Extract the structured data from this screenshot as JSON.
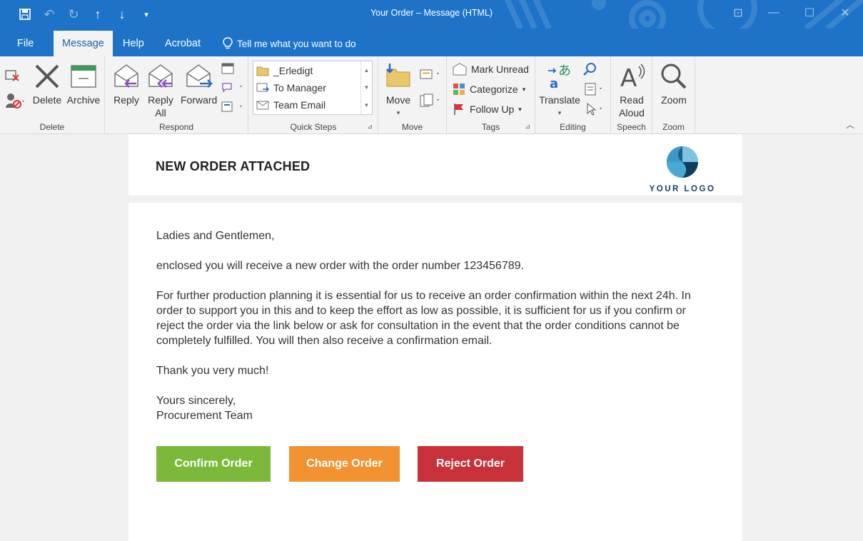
{
  "window": {
    "title": "Your Order  –  Message (HTML)"
  },
  "tabs": [
    {
      "label": "File"
    },
    {
      "label": "Message"
    },
    {
      "label": "Help"
    },
    {
      "label": "Acrobat"
    }
  ],
  "tell_me": "Tell me what you want to do",
  "ribbon": {
    "delete_group": {
      "label": "Delete",
      "delete": "Delete",
      "archive": "Archive"
    },
    "respond_group": {
      "label": "Respond",
      "reply": "Reply",
      "reply_all_1": "Reply",
      "reply_all_2": "All",
      "forward": "Forward"
    },
    "quick_steps": {
      "label": "Quick Steps",
      "items": [
        "_Erledigt",
        "To Manager",
        "Team Email"
      ]
    },
    "move_group": {
      "label": "Move",
      "move": "Move"
    },
    "tags_group": {
      "label": "Tags",
      "mark_unread": "Mark Unread",
      "categorize": "Categorize",
      "follow_up": "Follow Up"
    },
    "editing_group": {
      "label": "Editing",
      "translate": "Translate"
    },
    "speech_group": {
      "label": "Speech",
      "read_aloud_1": "Read",
      "read_aloud_2": "Aloud"
    },
    "zoom_group": {
      "label": "Zoom",
      "zoom": "Zoom"
    }
  },
  "message": {
    "heading": "NEW ORDER ATTACHED",
    "logo_text": "YOUR LOGO",
    "greeting": "Ladies and Gentlemen,",
    "line1": "enclosed you will receive a new order with the order number 123456789.",
    "paragraph_lines": [
      "For further production planning it is essential for us to receive an order confirmation within the next 24h. In",
      "order to support you in this and to keep the effort as low as possible, it is sufficient for us if you confirm or",
      "reject the order via the link below or ask for consultation in the event that the order conditions cannot be",
      "completely fulfilled. You will then also receive a confirmation email."
    ],
    "thanks": "Thank you very much!",
    "closing": "Yours sincerely,",
    "signature": "Procurement Team",
    "buttons": {
      "confirm": "Confirm Order",
      "change": "Change Order",
      "reject": "Reject Order"
    }
  },
  "colors": {
    "titlebar": "#1e73c8",
    "confirm": "#7cb83a",
    "change": "#f39231",
    "reject": "#c8303a"
  }
}
